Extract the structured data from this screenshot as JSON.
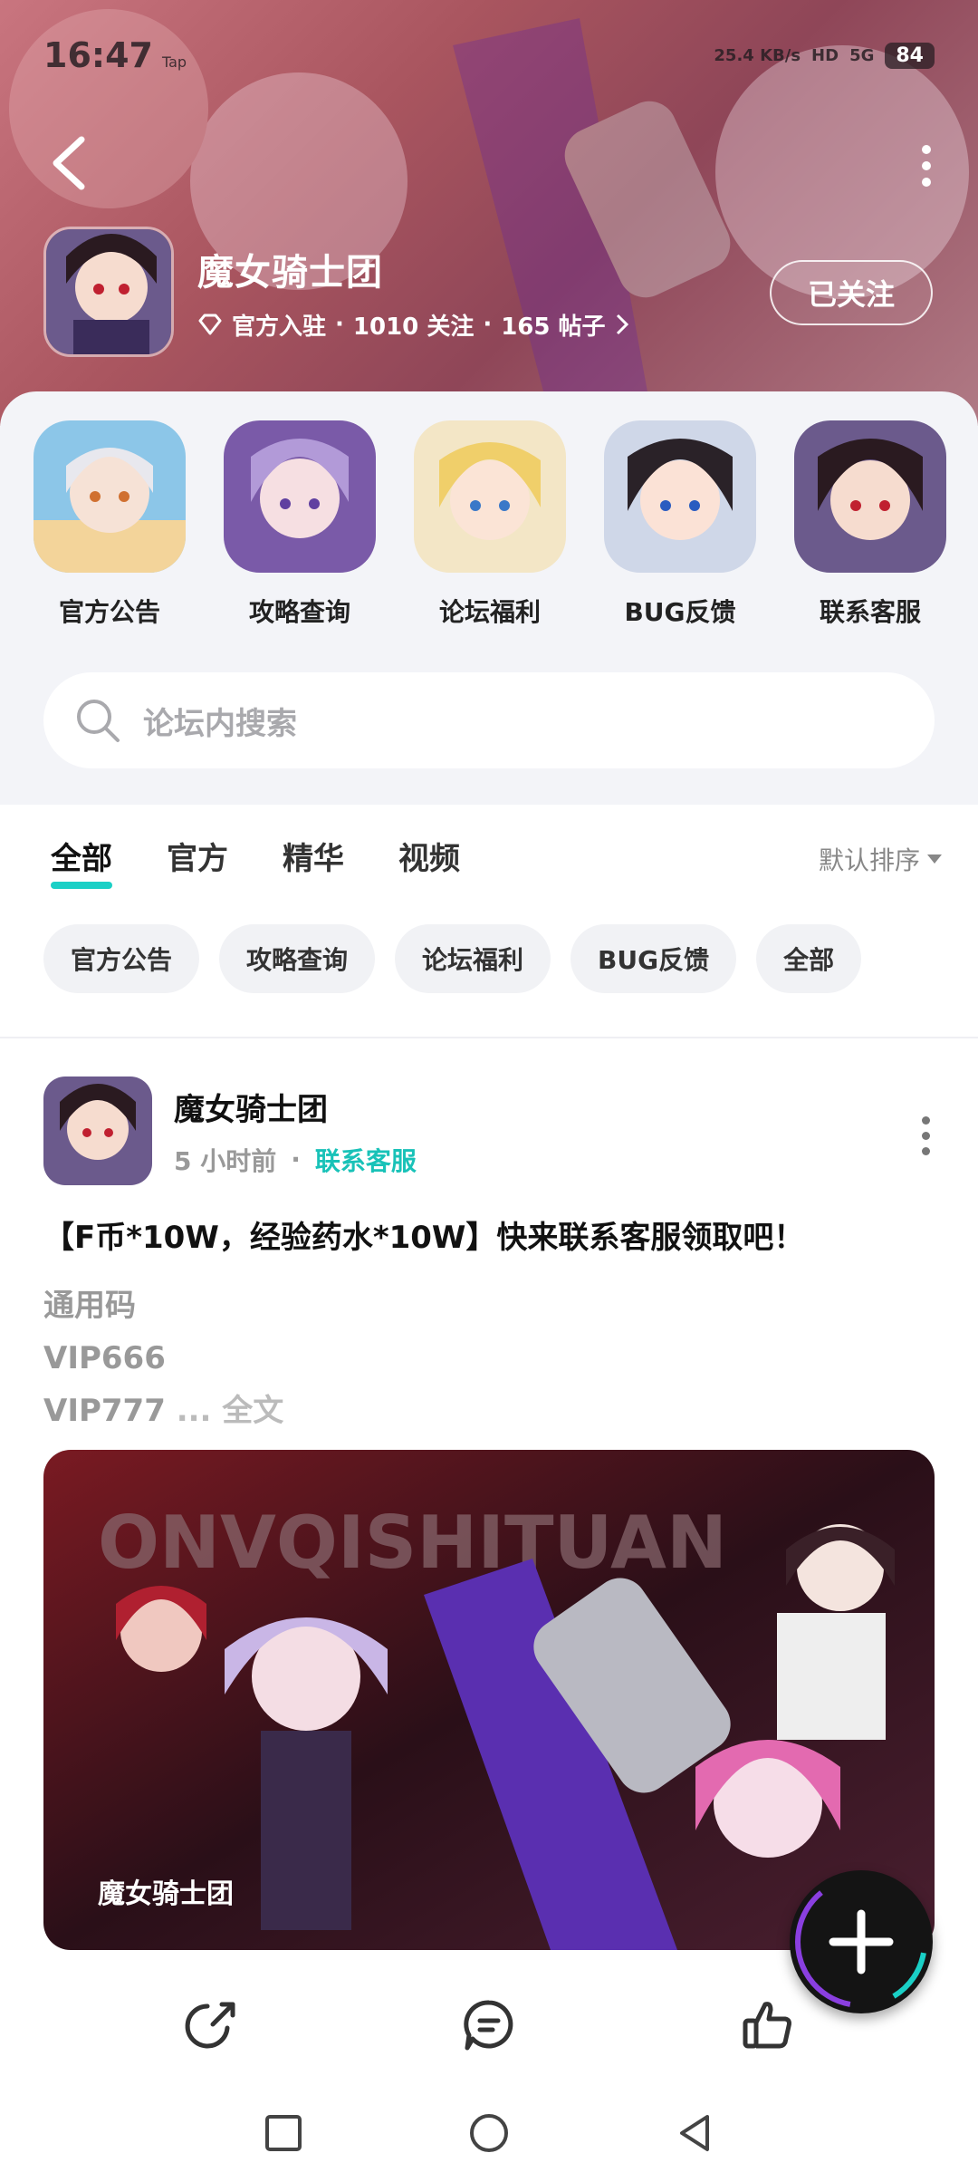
{
  "status_bar": {
    "time": "16:47",
    "tap": "Tap",
    "speed": "25.4 KB/s",
    "hd": "HD",
    "net": "5G",
    "battery": "84"
  },
  "group": {
    "name": "魔女骑士团",
    "badge": "官方入驻",
    "followers": "1010 关注",
    "posts": "165 帖子",
    "follow_label": "已关注"
  },
  "shortcuts": [
    {
      "label": "官方公告"
    },
    {
      "label": "攻略查询"
    },
    {
      "label": "论坛福利"
    },
    {
      "label": "BUG反馈"
    },
    {
      "label": "联系客服"
    }
  ],
  "search": {
    "placeholder": "论坛内搜索"
  },
  "tabs": [
    {
      "label": "全部",
      "active": true
    },
    {
      "label": "官方"
    },
    {
      "label": "精华"
    },
    {
      "label": "视频"
    }
  ],
  "sort_label": "默认排序",
  "chips": [
    "官方公告",
    "攻略查询",
    "论坛福利",
    "BUG反馈",
    "全部"
  ],
  "post": {
    "author": "魔女骑士团",
    "time": "5 小时前",
    "dot": "·",
    "tag": "联系客服",
    "title": "【F币*10W，经验药水*10W】快来联系客服领取吧！",
    "lines": [
      "通用码",
      "VIP666",
      "VIP777"
    ],
    "more_label": "... 全文",
    "image_caption": "魔女骑士团",
    "image_banner": "ONVQISHITUAN"
  },
  "colors": {
    "accent": "#1ad0c6",
    "header": "#a9555f"
  }
}
